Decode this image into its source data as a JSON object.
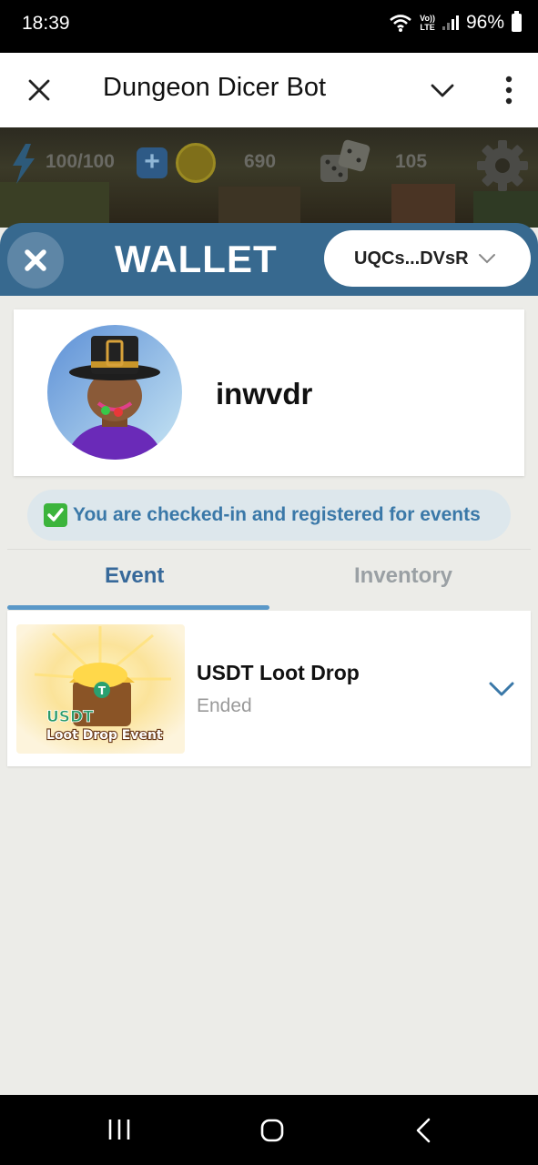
{
  "status_bar": {
    "time": "18:39",
    "network_label_top": "Vo))",
    "network_label_bottom": "LTE",
    "battery": "96%"
  },
  "header": {
    "title": "Dungeon Dicer Bot",
    "icons": [
      "close-icon",
      "chevron-down-icon",
      "more-vertical-icon"
    ]
  },
  "game_hud": {
    "energy": "100/100",
    "coins": "690",
    "dice": "105"
  },
  "wallet": {
    "title": "WALLET",
    "address": "UQCs...DVsR"
  },
  "profile": {
    "username": "inwvdr"
  },
  "checkin": {
    "message": "You are checked-in and registered for events"
  },
  "tabs": [
    {
      "label": "Event",
      "active": true
    },
    {
      "label": "Inventory",
      "active": false
    }
  ],
  "events": [
    {
      "title": "USDT Loot Drop",
      "status": "Ended",
      "thumb_label_top": "USDT",
      "thumb_label_bottom": "Loot Drop Event"
    }
  ],
  "colors": {
    "wallet_bar": "#37698f",
    "accent_blue": "#37699a",
    "tab_indicator": "#5a98c8",
    "checkin_bg": "#dde7ec",
    "page_bg": "#ecece8"
  }
}
